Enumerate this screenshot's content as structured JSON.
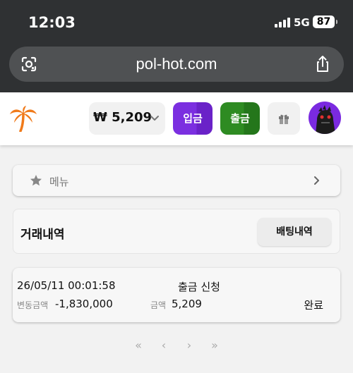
{
  "status_bar": {
    "time": "12:03",
    "network": "5G",
    "battery": "87"
  },
  "browser": {
    "url": "pol-hot.com",
    "icons": [
      "lens-icon",
      "share-icon"
    ]
  },
  "header": {
    "logo": "palm-tree-logo",
    "balance": "₩ 5,209",
    "deposit_label": "입금",
    "withdraw_label": "출금",
    "colors": {
      "deposit": "#7b2fe0",
      "withdraw": "#2e8b22",
      "accent_logo": "#f07a1a"
    }
  },
  "menu": {
    "label": "메뉴"
  },
  "history": {
    "title": "거래내역",
    "betting_button": "배팅내역"
  },
  "transactions": [
    {
      "datetime": "26/05/11 00:01:58",
      "type": "출금 신청",
      "change_label": "변동금액",
      "change_value": "-1,830,000",
      "amount_label": "금액",
      "amount_value": "5,209",
      "status": "완료"
    }
  ],
  "pagination": {
    "first": "«",
    "prev": "‹",
    "next": "›",
    "last": "»"
  }
}
